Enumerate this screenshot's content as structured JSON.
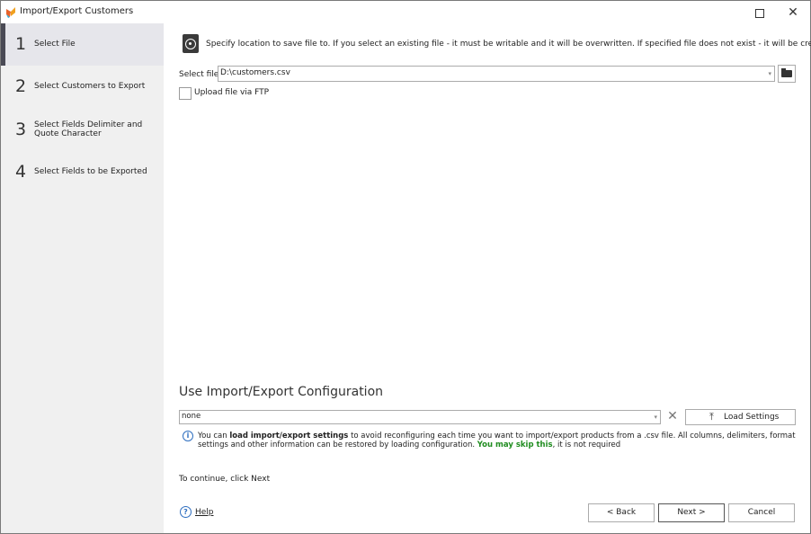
{
  "window": {
    "title": "Import/Export Customers",
    "maximize_icon": "maximize-icon",
    "close_glyph": "✕"
  },
  "sidebar": {
    "steps": [
      {
        "number": "1",
        "label": "Select File",
        "active": true
      },
      {
        "number": "2",
        "label": "Select Customers to Export",
        "active": false
      },
      {
        "number": "3",
        "label": "Select Fields Delimiter and Quote Character",
        "active": false
      },
      {
        "number": "4",
        "label": "Select Fields to be Exported",
        "active": false
      }
    ]
  },
  "main": {
    "instruction": "Specify location to save file to. If you select an existing file - it must be writable and it will be overwritten. If specified file does not exist - it will be created.",
    "select_file_label": "Select file",
    "select_file_value": "D:\\customers.csv",
    "dropdown_glyph": "▾",
    "upload_ftp_label": "Upload file via FTP",
    "upload_ftp_checked": false
  },
  "config": {
    "title": "Use Import/Export Configuration",
    "value": "none",
    "clear_glyph": "✕",
    "load_button_label": "Load Settings",
    "load_icon_glyph": "⤒",
    "info_glyph": "i",
    "info_prefix": "You can ",
    "info_bold": "load import/export settings",
    "info_middle": " to avoid reconfiguring each time you want to import/export products from a .csv file. All columns, delimiters, format settings and other information can be restored by loading configuration. ",
    "info_green": "You may skip this",
    "info_suffix": ", it is not required",
    "green_color": "#1f8c1f"
  },
  "footer": {
    "continue_text": "To continue, click Next",
    "help_glyph": "?",
    "help_label": "Help",
    "back_label": "< Back",
    "next_label": "Next >",
    "cancel_label": "Cancel"
  }
}
